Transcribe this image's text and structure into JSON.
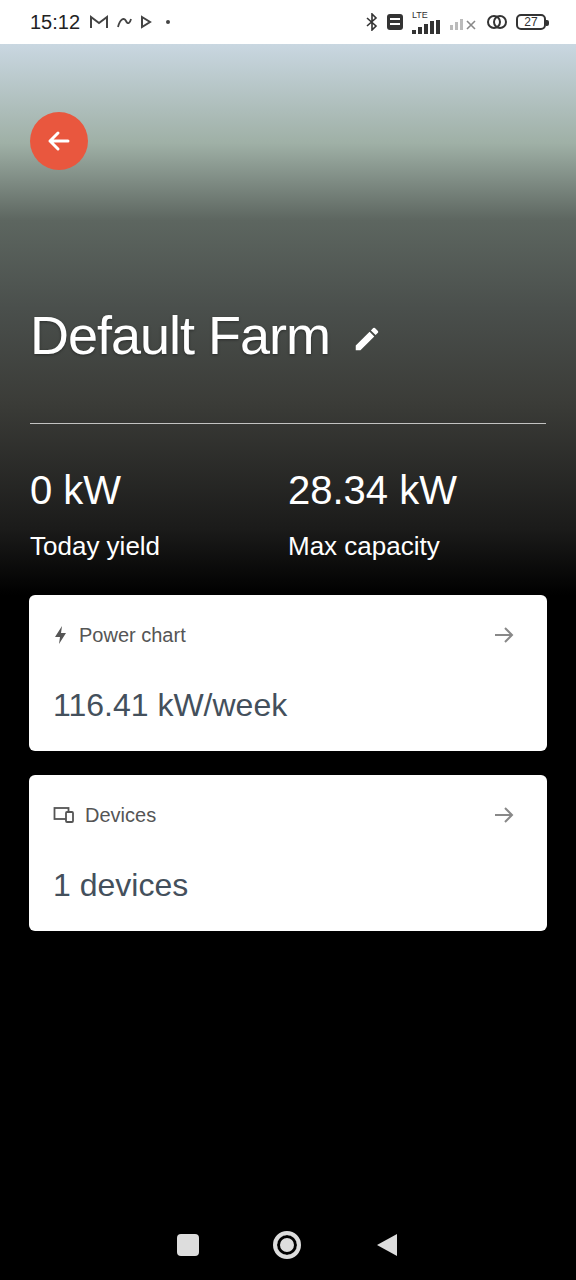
{
  "status_bar": {
    "time": "15:12",
    "network": "LTE",
    "battery": "27"
  },
  "farm": {
    "title": "Default Farm"
  },
  "stats": [
    {
      "value": "0 kW",
      "label": "Today yield"
    },
    {
      "value": "28.34 kW",
      "label": "Max capacity"
    }
  ],
  "cards": [
    {
      "kind": "power",
      "title": "Power chart",
      "value": "116.41 kW/week"
    },
    {
      "kind": "devices",
      "title": "Devices",
      "value": "1 devices"
    }
  ]
}
